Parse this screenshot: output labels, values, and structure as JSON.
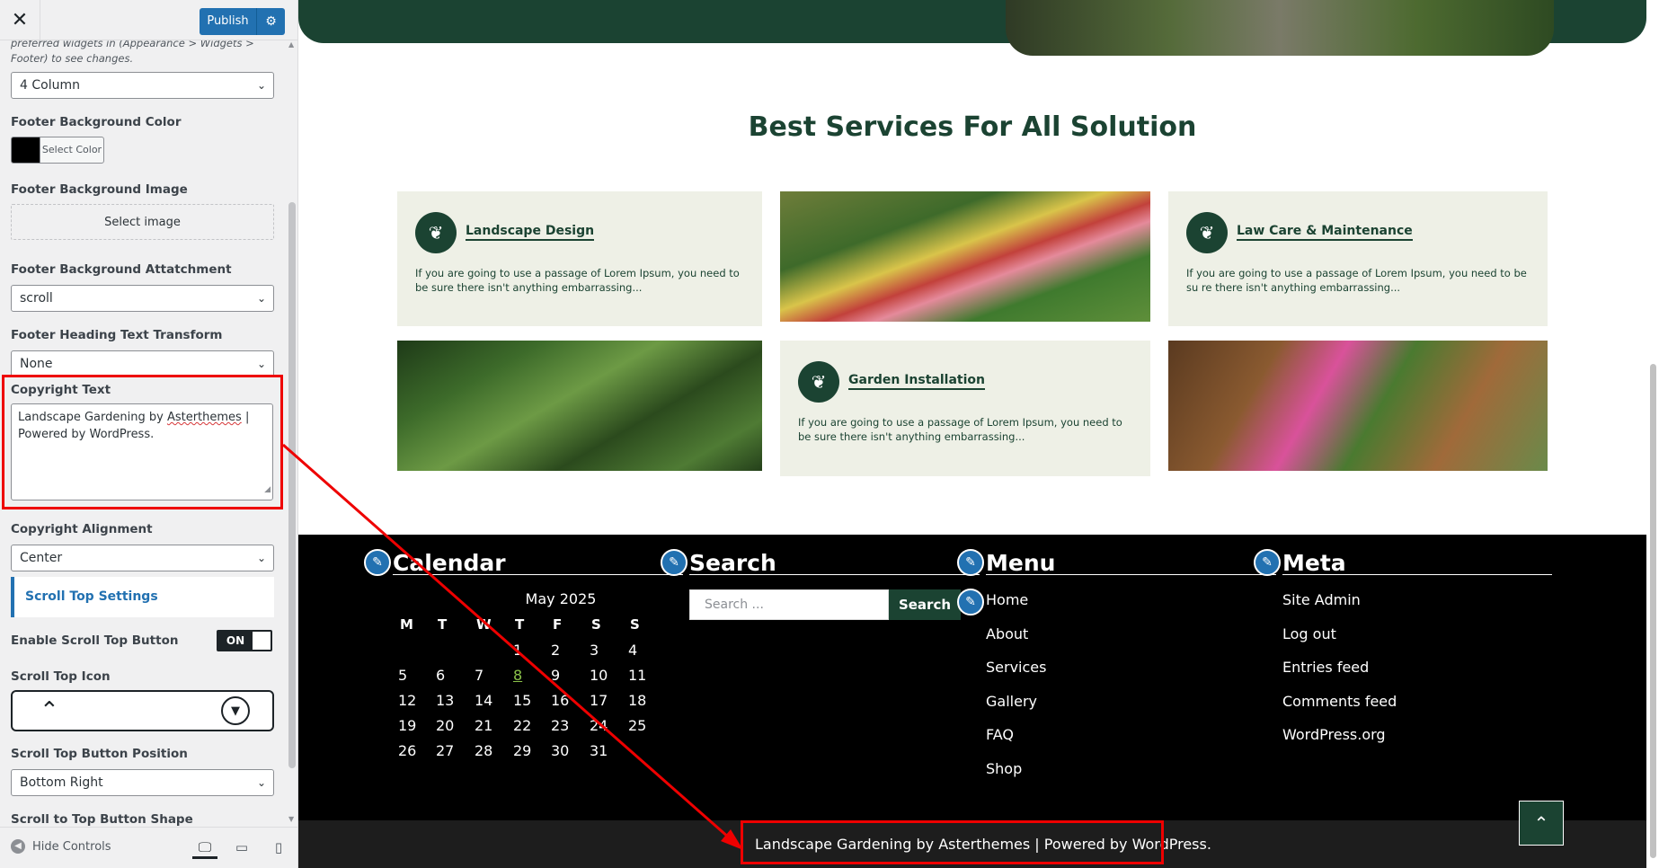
{
  "customizer": {
    "close_label": "✕",
    "publish_label": "Publish",
    "footer_widgets_desc": "preferred widgets in (Appearance > Widgets > Footer) to see changes.",
    "footer_columns": "4 Column",
    "bg_color_label": "Footer Background Color",
    "select_color": "Select Color",
    "bg_image_label": "Footer Background Image",
    "select_image": "Select image",
    "bg_attach_label": "Footer Background Attatchment",
    "bg_attach_value": "scroll",
    "heading_transform_label": "Footer Heading Text Transform",
    "heading_transform_value": "None",
    "copyright_label": "Copyright Text",
    "copyright_line1_a": "Landscape Gardening by ",
    "copyright_line1_b": "Asterthemes",
    "copyright_line1_c": " |",
    "copyright_line2": "Powered by WordPress.",
    "copyright_align_label": "Copyright Alignment",
    "copyright_align_value": "Center",
    "scroll_top_section": "Scroll Top Settings",
    "enable_scroll_label": "Enable Scroll Top Button",
    "toggle_on": "ON",
    "scroll_icon_label": "Scroll Top Icon",
    "scroll_pos_label": "Scroll Top Button Position",
    "scroll_pos_value": "Bottom Right",
    "scroll_shape_label": "Scroll to Top Button Shape",
    "hide_controls": "Hide Controls"
  },
  "services": {
    "title": "Best Services For All Solution",
    "cards": [
      {
        "title": "Landscape Design",
        "text": "If you are going to use a passage of Lorem Ipsum, you need to be sure there isn't anything embarrassing..."
      },
      {
        "title": "Law Care & Maintenance",
        "text": "If you are going to use a passage of Lorem Ipsum, you need to be su re there isn't anything embarrassing..."
      },
      {
        "title": "Garden Installation",
        "text": "If you are going to use a passage of Lorem Ipsum, you need to be sure there isn't anything embarrassing..."
      }
    ]
  },
  "footer": {
    "calendar_title": "Calendar",
    "calendar_caption": "May 2025",
    "weekdays": [
      "M",
      "T",
      "W",
      "T",
      "F",
      "S",
      "S"
    ],
    "weeks": [
      [
        "",
        "",
        "",
        "1",
        "2",
        "3",
        "4"
      ],
      [
        "5",
        "6",
        "7",
        "8",
        "9",
        "10",
        "11"
      ],
      [
        "12",
        "13",
        "14",
        "15",
        "16",
        "17",
        "18"
      ],
      [
        "19",
        "20",
        "21",
        "22",
        "23",
        "24",
        "25"
      ],
      [
        "26",
        "27",
        "28",
        "29",
        "30",
        "31",
        ""
      ]
    ],
    "today": "8",
    "search_title": "Search",
    "search_placeholder": "Search ...",
    "search_button": "Search",
    "menu_title": "Menu",
    "menu_items": [
      "Home",
      "About",
      "Services",
      "Gallery",
      "FAQ",
      "Shop"
    ],
    "meta_title": "Meta",
    "meta_items": [
      "Site Admin",
      "Log out",
      "Entries feed",
      "Comments feed",
      "WordPress.org"
    ],
    "copyright": "Landscape Gardening by Asterthemes | Powered by WordPress."
  },
  "colors": {
    "brand_green": "#1b4332",
    "wp_blue": "#2271b1",
    "annotation_red": "#ee0000"
  }
}
